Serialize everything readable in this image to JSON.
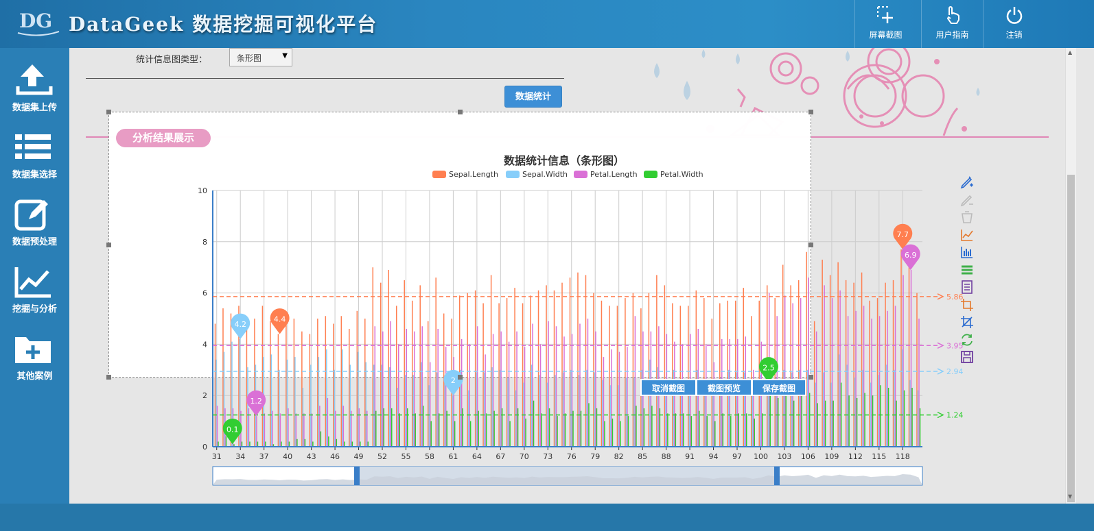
{
  "header": {
    "logo_text": "DG",
    "title": "DataGeek 数据挖掘可视化平台",
    "buttons": [
      {
        "label": "屏幕截图",
        "icon": "screenshot-plus-icon"
      },
      {
        "label": "用户指南",
        "icon": "hand-pointer-icon"
      },
      {
        "label": "注销",
        "icon": "power-icon"
      }
    ]
  },
  "sidebar": {
    "items": [
      {
        "label": "数据集上传",
        "icon": "upload-icon"
      },
      {
        "label": "数据集选择",
        "icon": "list-icon"
      },
      {
        "label": "数据预处理",
        "icon": "edit-icon"
      },
      {
        "label": "挖掘与分析",
        "icon": "line-chart-icon"
      },
      {
        "label": "其他案例",
        "icon": "folder-plus-icon"
      }
    ]
  },
  "controls": {
    "type_label": "统计信息图类型：",
    "type_value": "条形图",
    "stat_button": "数据统计"
  },
  "section": {
    "title": "分析结果展示"
  },
  "capture": {
    "cancel": "取消截图",
    "preview": "截图预览",
    "save": "保存截图"
  },
  "toolbox": [
    "mark-pen-icon",
    "mark-undo-icon",
    "mark-clear-icon",
    "line-chart-icon",
    "bar-chart-icon",
    "stack-icon",
    "data-view-icon",
    "zoom-icon",
    "zoom-reset-icon",
    "restore-icon",
    "save-image-icon"
  ],
  "colors": {
    "sepal_length": "#ff7f50",
    "sepal_width": "#87cefa",
    "petal_length": "#da70d6",
    "petal_width": "#32cd32"
  },
  "chart_data": {
    "type": "bar",
    "title": "数据统计信息（条形图）",
    "ylim": [
      0,
      10
    ],
    "yticks": [
      "0",
      "2",
      "4",
      "6",
      "8",
      "10"
    ],
    "xticks": [
      "31",
      "34",
      "37",
      "40",
      "43",
      "46",
      "49",
      "52",
      "55",
      "58",
      "61",
      "64",
      "67",
      "70",
      "73",
      "76",
      "79",
      "82",
      "85",
      "88",
      "91",
      "94",
      "97",
      "100",
      "103",
      "106",
      "109",
      "112",
      "115",
      "118"
    ],
    "x": [
      31,
      32,
      33,
      34,
      35,
      36,
      37,
      38,
      39,
      40,
      41,
      42,
      43,
      44,
      45,
      46,
      47,
      48,
      49,
      50,
      51,
      52,
      53,
      54,
      55,
      56,
      57,
      58,
      59,
      60,
      61,
      62,
      63,
      64,
      65,
      66,
      67,
      68,
      69,
      70,
      71,
      72,
      73,
      74,
      75,
      76,
      77,
      78,
      79,
      80,
      81,
      82,
      83,
      84,
      85,
      86,
      87,
      88,
      89,
      90,
      91,
      92,
      93,
      94,
      95,
      96,
      97,
      98,
      99,
      100,
      101,
      102,
      103,
      104,
      105,
      106,
      107,
      108,
      109,
      110,
      111,
      112,
      113,
      114,
      115,
      116,
      117,
      118,
      119,
      120
    ],
    "legend_position": "top-center",
    "grid": true,
    "series": [
      {
        "name": "Sepal.Length",
        "color": "#ff7f50",
        "mean": 5.86,
        "max_label": "7.7",
        "min_label": "4.4",
        "values": [
          4.8,
          5.4,
          5.2,
          5.5,
          4.9,
          5.0,
          5.5,
          4.9,
          4.4,
          5.1,
          5.0,
          4.5,
          4.4,
          5.0,
          5.1,
          4.8,
          5.1,
          4.6,
          5.3,
          5.0,
          7.0,
          6.4,
          6.9,
          5.5,
          6.5,
          5.7,
          6.3,
          4.9,
          6.6,
          5.2,
          5.0,
          5.9,
          6.0,
          6.1,
          5.6,
          6.7,
          5.6,
          5.8,
          6.2,
          5.6,
          5.9,
          6.1,
          6.3,
          6.1,
          6.4,
          6.6,
          6.8,
          6.7,
          6.0,
          5.7,
          5.5,
          5.5,
          5.8,
          6.0,
          5.4,
          6.0,
          6.7,
          6.3,
          5.6,
          5.5,
          5.5,
          6.1,
          5.8,
          5.0,
          5.6,
          5.7,
          5.7,
          6.2,
          5.1,
          5.7,
          6.3,
          5.8,
          7.1,
          6.3,
          6.5,
          7.6,
          4.9,
          7.3,
          6.7,
          7.2,
          6.5,
          6.4,
          6.8,
          5.7,
          5.8,
          6.4,
          6.5,
          7.7,
          7.7,
          6.0
        ]
      },
      {
        "name": "Sepal.Width",
        "color": "#87cefa",
        "mean": 2.94,
        "max_label": "4.2",
        "min_label": "2",
        "values": [
          3.4,
          3.7,
          4.1,
          4.2,
          3.1,
          3.2,
          3.5,
          3.6,
          3.0,
          3.4,
          3.5,
          2.3,
          3.2,
          3.5,
          3.8,
          3.0,
          3.8,
          3.2,
          3.7,
          3.3,
          3.2,
          3.2,
          3.1,
          2.3,
          2.8,
          2.8,
          3.3,
          2.4,
          2.9,
          2.7,
          2.0,
          3.0,
          2.2,
          2.9,
          2.9,
          3.1,
          3.0,
          2.7,
          2.2,
          2.5,
          3.2,
          2.8,
          2.5,
          2.8,
          2.9,
          3.0,
          2.8,
          3.0,
          2.9,
          2.6,
          2.4,
          2.4,
          2.7,
          2.7,
          3.0,
          3.4,
          3.1,
          2.3,
          3.0,
          2.5,
          2.6,
          3.0,
          2.6,
          2.3,
          2.7,
          3.0,
          2.9,
          2.9,
          2.5,
          2.8,
          3.3,
          2.7,
          3.0,
          2.9,
          3.0,
          3.0,
          2.5,
          2.9,
          2.5,
          3.6,
          3.2,
          2.7,
          3.0,
          2.5,
          2.8,
          3.2,
          3.0,
          3.8,
          2.6,
          2.2
        ]
      },
      {
        "name": "Petal.Length",
        "color": "#da70d6",
        "mean": 3.95,
        "max_label": "6.9",
        "min_label": "1.2",
        "values": [
          1.6,
          1.5,
          1.5,
          1.4,
          1.5,
          1.2,
          1.3,
          1.4,
          1.3,
          1.5,
          1.3,
          1.3,
          1.3,
          1.6,
          1.9,
          1.4,
          1.6,
          1.4,
          1.5,
          1.4,
          4.7,
          4.5,
          4.9,
          4.0,
          4.6,
          4.5,
          4.7,
          3.3,
          4.6,
          3.9,
          3.5,
          4.2,
          4.0,
          4.7,
          3.6,
          4.4,
          4.5,
          4.1,
          4.5,
          3.9,
          4.8,
          4.0,
          4.9,
          4.7,
          4.3,
          4.4,
          4.8,
          5.0,
          4.5,
          3.5,
          3.8,
          3.7,
          3.9,
          5.1,
          4.5,
          4.5,
          4.7,
          4.4,
          4.1,
          4.0,
          4.4,
          4.6,
          4.0,
          3.3,
          4.2,
          4.2,
          4.2,
          4.3,
          3.0,
          4.1,
          6.0,
          5.1,
          5.9,
          5.6,
          5.8,
          6.6,
          4.5,
          6.3,
          5.8,
          6.1,
          5.1,
          5.3,
          5.5,
          5.0,
          5.1,
          5.3,
          5.5,
          6.7,
          6.9,
          5.0
        ]
      },
      {
        "name": "Petal.Width",
        "color": "#32cd32",
        "mean": 1.24,
        "max_label": "2.5",
        "min_label": "0.1",
        "values": [
          0.2,
          0.4,
          0.1,
          0.2,
          0.2,
          0.2,
          0.2,
          0.1,
          0.2,
          0.2,
          0.3,
          0.3,
          0.2,
          0.6,
          0.4,
          0.3,
          0.2,
          0.2,
          0.2,
          0.2,
          1.4,
          1.5,
          1.5,
          1.3,
          1.5,
          1.3,
          1.6,
          1.0,
          1.3,
          1.4,
          1.0,
          1.5,
          1.0,
          1.4,
          1.3,
          1.4,
          1.5,
          1.0,
          1.5,
          1.1,
          1.8,
          1.3,
          1.5,
          1.2,
          1.3,
          1.4,
          1.4,
          1.7,
          1.5,
          1.0,
          1.1,
          1.0,
          1.2,
          1.6,
          1.5,
          1.6,
          1.5,
          1.3,
          1.3,
          1.3,
          1.2,
          1.4,
          1.2,
          1.0,
          1.3,
          1.2,
          1.3,
          1.3,
          1.1,
          1.3,
          2.5,
          1.9,
          2.1,
          1.8,
          2.2,
          2.1,
          1.7,
          1.8,
          1.8,
          2.5,
          2.0,
          1.9,
          2.1,
          2.0,
          2.4,
          2.3,
          1.8,
          2.2,
          2.3,
          1.5
        ]
      }
    ]
  }
}
